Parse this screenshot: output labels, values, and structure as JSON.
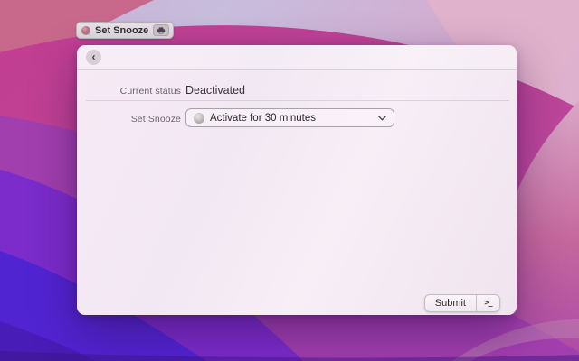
{
  "command_bar": {
    "title": "Set Snooze",
    "app_icon": "app-icon",
    "device_icon": "printer-icon"
  },
  "window": {
    "back_glyph": "‹"
  },
  "form": {
    "status_label": "Current status",
    "status_value": "Deactivated",
    "snooze_label": "Set Snooze",
    "snooze_value": "Activate for 30 minutes",
    "snooze_icon": "clock-icon",
    "dropdown_icon": "chevron-down-icon"
  },
  "actions": {
    "submit_label": "Submit",
    "shortcut_glyph": ">_",
    "shortcut_icon": "terminal-prompt-icon"
  },
  "colors": {
    "window_bg": "#f4e9f3",
    "band_coral": "#c8698c",
    "band_magenta": "#c23e92",
    "band_purple": "#a23fae",
    "band_violet": "#7b2cca",
    "band_blueviolet": "#5124d2",
    "rosy_right": "#c4679c",
    "pink_topright": "#e2b2cb"
  }
}
